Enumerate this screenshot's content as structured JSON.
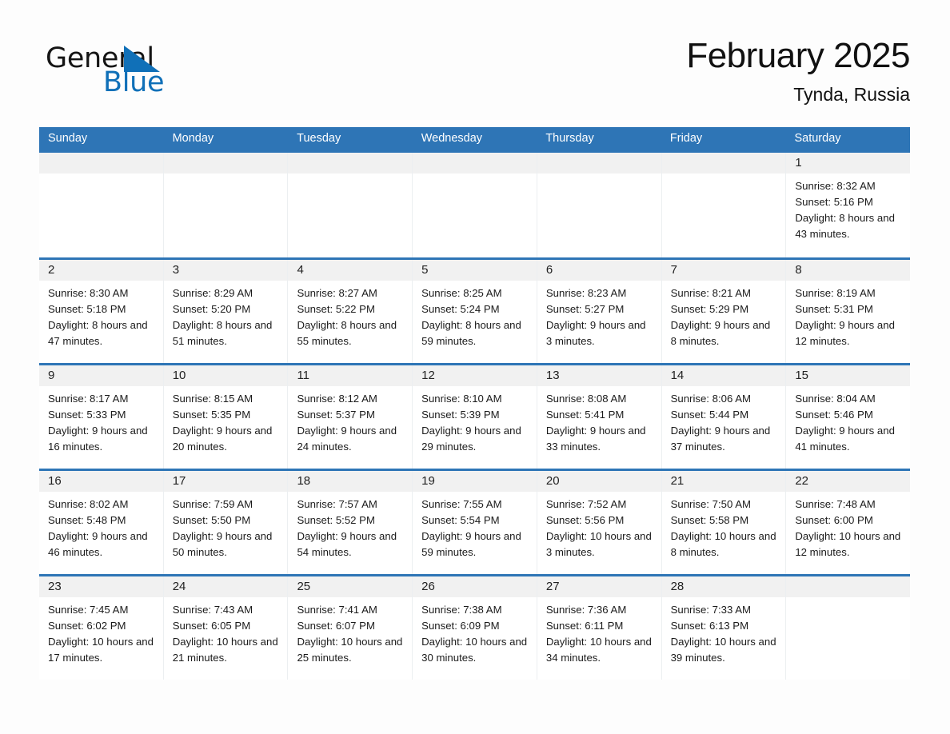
{
  "brand": {
    "name_part1": "General",
    "name_part2": "Blue",
    "accent_color": "#1070b8"
  },
  "header": {
    "title": "February 2025",
    "location": "Tynda, Russia"
  },
  "colors": {
    "header_blue": "#2e75b6",
    "day_band_gray": "#f1f1f1",
    "page_background": "#fdfdfd"
  },
  "weekdays": [
    "Sunday",
    "Monday",
    "Tuesday",
    "Wednesday",
    "Thursday",
    "Friday",
    "Saturday"
  ],
  "weeks": [
    [
      {
        "day": "",
        "sunrise": "",
        "sunset": "",
        "daylight": ""
      },
      {
        "day": "",
        "sunrise": "",
        "sunset": "",
        "daylight": ""
      },
      {
        "day": "",
        "sunrise": "",
        "sunset": "",
        "daylight": ""
      },
      {
        "day": "",
        "sunrise": "",
        "sunset": "",
        "daylight": ""
      },
      {
        "day": "",
        "sunrise": "",
        "sunset": "",
        "daylight": ""
      },
      {
        "day": "",
        "sunrise": "",
        "sunset": "",
        "daylight": ""
      },
      {
        "day": "1",
        "sunrise": "Sunrise: 8:32 AM",
        "sunset": "Sunset: 5:16 PM",
        "daylight": "Daylight: 8 hours and 43 minutes."
      }
    ],
    [
      {
        "day": "2",
        "sunrise": "Sunrise: 8:30 AM",
        "sunset": "Sunset: 5:18 PM",
        "daylight": "Daylight: 8 hours and 47 minutes."
      },
      {
        "day": "3",
        "sunrise": "Sunrise: 8:29 AM",
        "sunset": "Sunset: 5:20 PM",
        "daylight": "Daylight: 8 hours and 51 minutes."
      },
      {
        "day": "4",
        "sunrise": "Sunrise: 8:27 AM",
        "sunset": "Sunset: 5:22 PM",
        "daylight": "Daylight: 8 hours and 55 minutes."
      },
      {
        "day": "5",
        "sunrise": "Sunrise: 8:25 AM",
        "sunset": "Sunset: 5:24 PM",
        "daylight": "Daylight: 8 hours and 59 minutes."
      },
      {
        "day": "6",
        "sunrise": "Sunrise: 8:23 AM",
        "sunset": "Sunset: 5:27 PM",
        "daylight": "Daylight: 9 hours and 3 minutes."
      },
      {
        "day": "7",
        "sunrise": "Sunrise: 8:21 AM",
        "sunset": "Sunset: 5:29 PM",
        "daylight": "Daylight: 9 hours and 8 minutes."
      },
      {
        "day": "8",
        "sunrise": "Sunrise: 8:19 AM",
        "sunset": "Sunset: 5:31 PM",
        "daylight": "Daylight: 9 hours and 12 minutes."
      }
    ],
    [
      {
        "day": "9",
        "sunrise": "Sunrise: 8:17 AM",
        "sunset": "Sunset: 5:33 PM",
        "daylight": "Daylight: 9 hours and 16 minutes."
      },
      {
        "day": "10",
        "sunrise": "Sunrise: 8:15 AM",
        "sunset": "Sunset: 5:35 PM",
        "daylight": "Daylight: 9 hours and 20 minutes."
      },
      {
        "day": "11",
        "sunrise": "Sunrise: 8:12 AM",
        "sunset": "Sunset: 5:37 PM",
        "daylight": "Daylight: 9 hours and 24 minutes."
      },
      {
        "day": "12",
        "sunrise": "Sunrise: 8:10 AM",
        "sunset": "Sunset: 5:39 PM",
        "daylight": "Daylight: 9 hours and 29 minutes."
      },
      {
        "day": "13",
        "sunrise": "Sunrise: 8:08 AM",
        "sunset": "Sunset: 5:41 PM",
        "daylight": "Daylight: 9 hours and 33 minutes."
      },
      {
        "day": "14",
        "sunrise": "Sunrise: 8:06 AM",
        "sunset": "Sunset: 5:44 PM",
        "daylight": "Daylight: 9 hours and 37 minutes."
      },
      {
        "day": "15",
        "sunrise": "Sunrise: 8:04 AM",
        "sunset": "Sunset: 5:46 PM",
        "daylight": "Daylight: 9 hours and 41 minutes."
      }
    ],
    [
      {
        "day": "16",
        "sunrise": "Sunrise: 8:02 AM",
        "sunset": "Sunset: 5:48 PM",
        "daylight": "Daylight: 9 hours and 46 minutes."
      },
      {
        "day": "17",
        "sunrise": "Sunrise: 7:59 AM",
        "sunset": "Sunset: 5:50 PM",
        "daylight": "Daylight: 9 hours and 50 minutes."
      },
      {
        "day": "18",
        "sunrise": "Sunrise: 7:57 AM",
        "sunset": "Sunset: 5:52 PM",
        "daylight": "Daylight: 9 hours and 54 minutes."
      },
      {
        "day": "19",
        "sunrise": "Sunrise: 7:55 AM",
        "sunset": "Sunset: 5:54 PM",
        "daylight": "Daylight: 9 hours and 59 minutes."
      },
      {
        "day": "20",
        "sunrise": "Sunrise: 7:52 AM",
        "sunset": "Sunset: 5:56 PM",
        "daylight": "Daylight: 10 hours and 3 minutes."
      },
      {
        "day": "21",
        "sunrise": "Sunrise: 7:50 AM",
        "sunset": "Sunset: 5:58 PM",
        "daylight": "Daylight: 10 hours and 8 minutes."
      },
      {
        "day": "22",
        "sunrise": "Sunrise: 7:48 AM",
        "sunset": "Sunset: 6:00 PM",
        "daylight": "Daylight: 10 hours and 12 minutes."
      }
    ],
    [
      {
        "day": "23",
        "sunrise": "Sunrise: 7:45 AM",
        "sunset": "Sunset: 6:02 PM",
        "daylight": "Daylight: 10 hours and 17 minutes."
      },
      {
        "day": "24",
        "sunrise": "Sunrise: 7:43 AM",
        "sunset": "Sunset: 6:05 PM",
        "daylight": "Daylight: 10 hours and 21 minutes."
      },
      {
        "day": "25",
        "sunrise": "Sunrise: 7:41 AM",
        "sunset": "Sunset: 6:07 PM",
        "daylight": "Daylight: 10 hours and 25 minutes."
      },
      {
        "day": "26",
        "sunrise": "Sunrise: 7:38 AM",
        "sunset": "Sunset: 6:09 PM",
        "daylight": "Daylight: 10 hours and 30 minutes."
      },
      {
        "day": "27",
        "sunrise": "Sunrise: 7:36 AM",
        "sunset": "Sunset: 6:11 PM",
        "daylight": "Daylight: 10 hours and 34 minutes."
      },
      {
        "day": "28",
        "sunrise": "Sunrise: 7:33 AM",
        "sunset": "Sunset: 6:13 PM",
        "daylight": "Daylight: 10 hours and 39 minutes."
      },
      {
        "day": "",
        "sunrise": "",
        "sunset": "",
        "daylight": ""
      }
    ]
  ]
}
